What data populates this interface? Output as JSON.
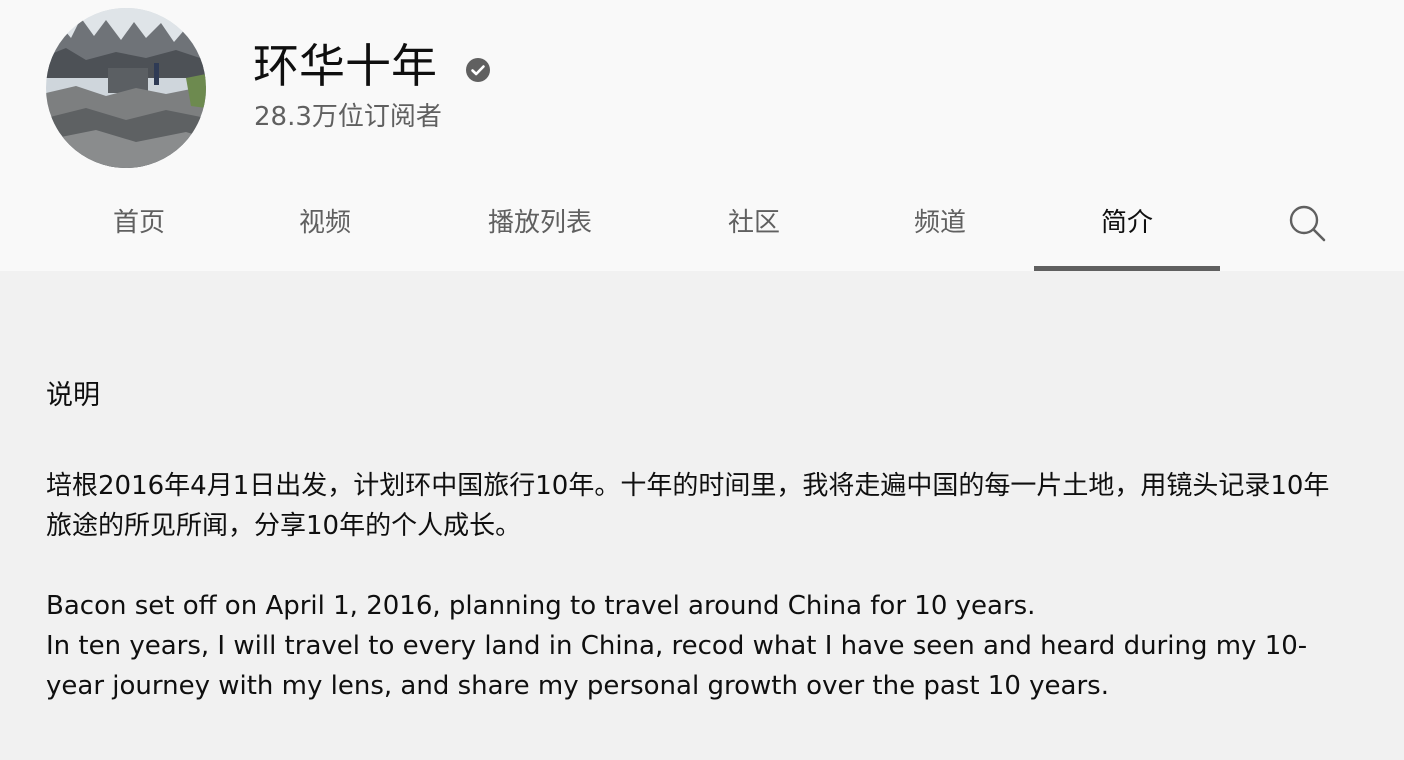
{
  "channel": {
    "name": "环华十年",
    "subscribers": "28.3万位订阅者",
    "verified": true
  },
  "tabs": [
    {
      "label": "首页",
      "active": false
    },
    {
      "label": "视频",
      "active": false
    },
    {
      "label": "播放列表",
      "active": false
    },
    {
      "label": "社区",
      "active": false
    },
    {
      "label": "频道",
      "active": false
    },
    {
      "label": "简介",
      "active": true
    }
  ],
  "about": {
    "section_title": "说明",
    "description_cn": "培根2016年4月1日出发，计划环中国旅行10年。十年的时间里，我将走遍中国的每一片土地，用镜头记录10年旅途的所见所闻，分享10年的个人成长。",
    "description_en_1": "Bacon set off on April 1, 2016, planning to travel around China for 10 years.",
    "description_en_2": "In ten years, I will travel to every land in China, recod what I have seen and heard during my 10-year journey with my lens, and share my personal growth over the past 10 years."
  },
  "colors": {
    "header_bg": "#f9f9f9",
    "page_bg": "#f1f1f1",
    "text_primary": "#0f0f0f",
    "text_secondary": "#606060"
  },
  "icons": {
    "verified": "verified-check-icon",
    "search": "search-icon"
  }
}
